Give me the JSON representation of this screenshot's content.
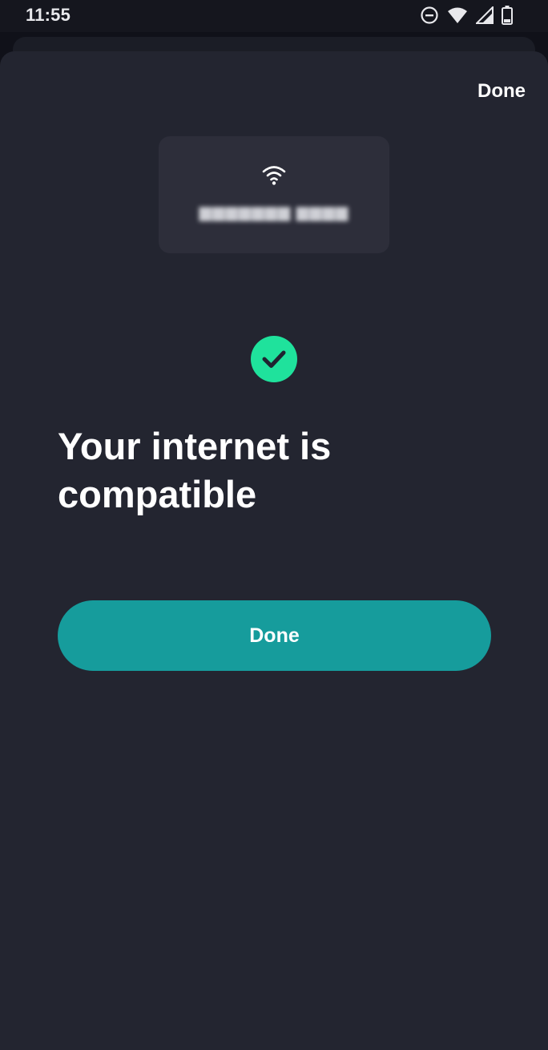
{
  "status_bar": {
    "time": "11:55",
    "icons": [
      "do-not-disturb-icon",
      "wifi-signal-icon",
      "cell-signal-icon",
      "battery-icon"
    ]
  },
  "sheet": {
    "top_action_label": "Done",
    "network_card": {
      "icon": "wifi-icon",
      "network_name": "▆▆▆▆▆▆▆ ▆▆▆▆"
    },
    "status_icon": "check-circle-icon",
    "headline": "Your internet is compatible",
    "primary_button_label": "Done"
  },
  "colors": {
    "sheet_background": "#232530",
    "card_background": "#2d2e3a",
    "accent_button": "#169c9c",
    "success_green": "#1fe29c",
    "text_primary": "#ffffff"
  }
}
